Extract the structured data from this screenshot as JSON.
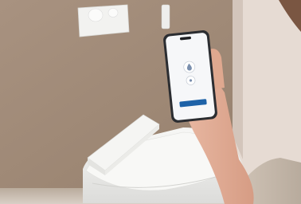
{
  "phone": {
    "app_title": "",
    "subtitle": "",
    "primary_action_label": ""
  },
  "colors": {
    "wall": "#a58f7b",
    "wall_shadow": "#8d7a68",
    "right_wall": "#e2d6cf",
    "phone_body": "#2b2d31",
    "accent": "#1d62a8",
    "toilet": "#f3f3f1"
  },
  "icons": [
    "flush-plate-icon",
    "water-drop-icon",
    "nozzle-icon"
  ]
}
